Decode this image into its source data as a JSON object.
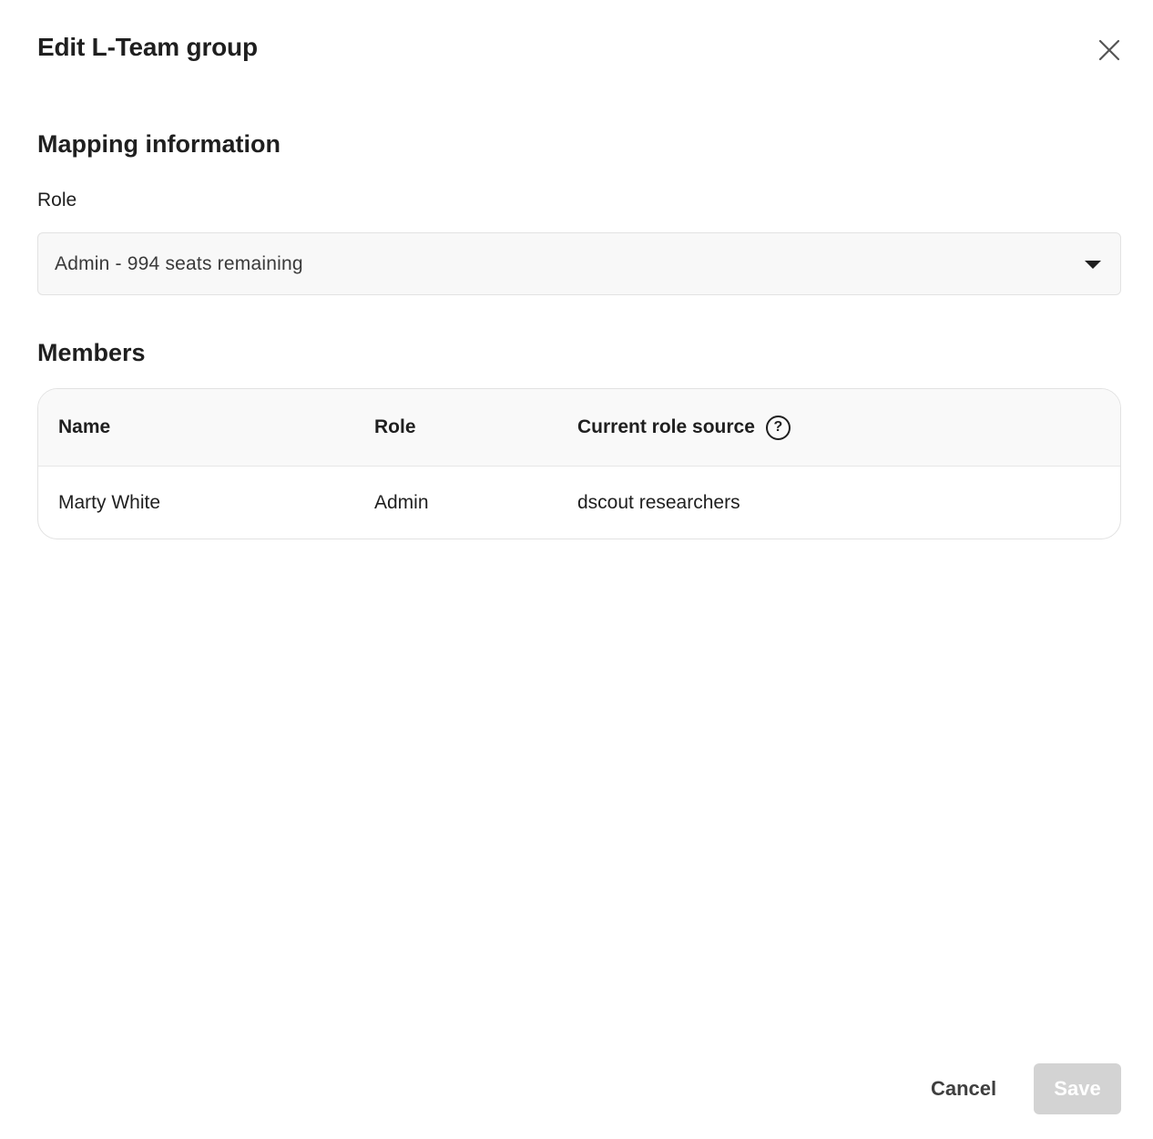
{
  "modal": {
    "title": "Edit L-Team group"
  },
  "mapping": {
    "section_title": "Mapping information",
    "role_label": "Role",
    "role_select_value": "Admin - 994 seats remaining"
  },
  "members": {
    "section_title": "Members",
    "columns": [
      "Name",
      "Role",
      "Current role source"
    ],
    "rows": [
      {
        "name": "Marty White",
        "role": "Admin",
        "source": "dscout researchers"
      }
    ]
  },
  "footer": {
    "cancel_label": "Cancel",
    "save_label": "Save"
  },
  "icons": {
    "close": "close-icon",
    "caret": "caret-down-icon",
    "help": "help-circle-icon"
  },
  "colors": {
    "text": "#1f1f1f",
    "border": "#e2e2e2",
    "save_disabled": "#d3d3d3"
  }
}
